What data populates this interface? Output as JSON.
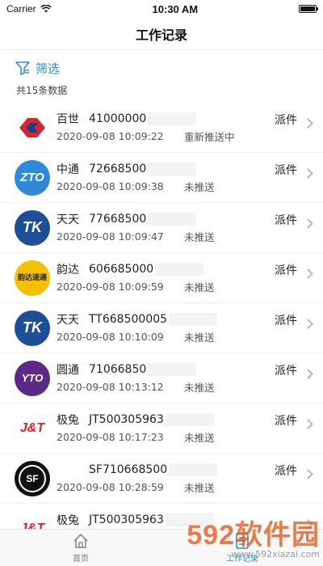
{
  "status_bar": {
    "carrier": "Carrier",
    "time": "10:30 AM"
  },
  "nav": {
    "title": "工作记录"
  },
  "filter": {
    "label": "筛选"
  },
  "summary": {
    "count_text": "共15条数据"
  },
  "records": [
    {
      "logo": "baishi",
      "company": "百世",
      "tracking": "41000000",
      "time": "2020-09-08 10:09:22",
      "status": "重新推送中",
      "type": "派件"
    },
    {
      "logo": "zto",
      "logo_text": "ZTO",
      "company": "中通",
      "tracking": "72668500",
      "time": "2020-09-08 10:09:38",
      "status": "未推送",
      "type": "派件"
    },
    {
      "logo": "tiantian",
      "logo_text": "TK",
      "company": "天天",
      "tracking": "77668500",
      "time": "2020-09-08 10:09:47",
      "status": "未推送",
      "type": "派件"
    },
    {
      "logo": "yunda",
      "logo_text": "韵达速递",
      "company": "韵达",
      "tracking": "606685000",
      "time": "2020-09-08 10:09:59",
      "status": "未推送",
      "type": "派件"
    },
    {
      "logo": "tiantian",
      "logo_text": "TK",
      "company": "天天",
      "tracking": "TT668500005",
      "time": "2020-09-08 10:10:09",
      "status": "未推送",
      "type": "派件"
    },
    {
      "logo": "yto",
      "logo_text": "YTO",
      "company": "圆通",
      "tracking": "71066850",
      "time": "2020-09-08 10:13:12",
      "status": "未推送",
      "type": "派件"
    },
    {
      "logo": "jtexp",
      "logo_text": "J&T",
      "company": "极兔",
      "tracking": "JT500305963",
      "time": "2020-09-08 10:17:23",
      "status": "未推送",
      "type": "派件"
    },
    {
      "logo": "sf",
      "logo_text": "SF",
      "company": "",
      "tracking": "SF710668500",
      "time": "2020-09-08 10:28:59",
      "status": "未推送",
      "type": "派件"
    },
    {
      "logo": "jtexp",
      "logo_text": "J&T",
      "company": "极兔",
      "tracking": "JT500305963",
      "time": "",
      "status": "",
      "type": ""
    }
  ],
  "tabs": [
    {
      "label": "首页",
      "icon": "home-icon",
      "active": false
    },
    {
      "label": "工作记录",
      "icon": "document-icon",
      "active": true
    }
  ],
  "watermark": {
    "big": "592软件园",
    "small": "www.592xiazai.com"
  },
  "colors": {
    "accent": "#2a8fd6",
    "watermark": "#e5571a"
  }
}
